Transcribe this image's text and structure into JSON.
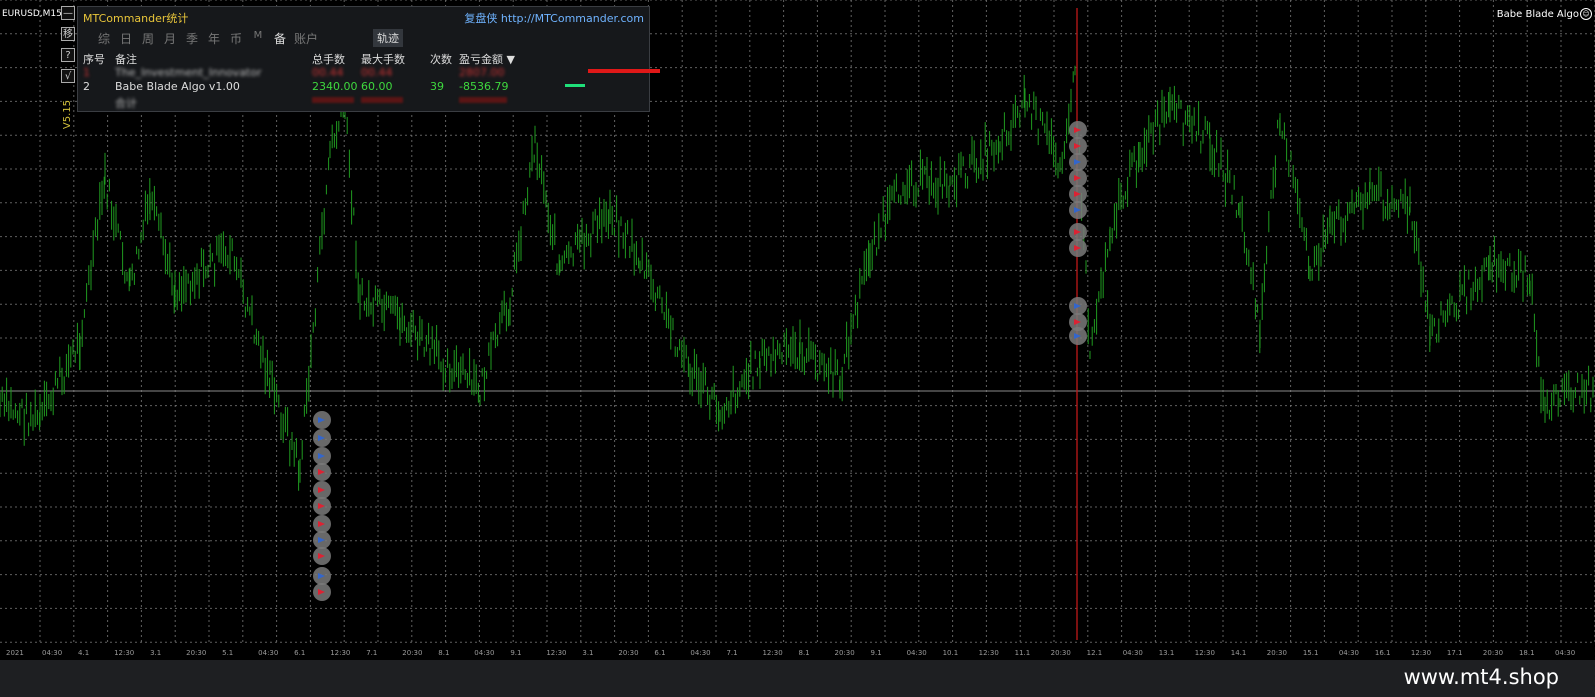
{
  "chart": {
    "symbol": "EURUSD,M15",
    "ea_name": "Babe Blade Algo",
    "smile_icon": "smile-icon",
    "version_label": "V5.15",
    "colors": {
      "background": "#000000",
      "grid": "#7a7a7a",
      "candles": "#1f9a1f",
      "cursor_line": "#c01818",
      "price_line": "#8a8a8a"
    }
  },
  "side_buttons": [
    {
      "label": "—",
      "icon": "minimize-icon"
    },
    {
      "label": "移",
      "icon": "move-icon"
    },
    {
      "label": "?",
      "icon": "help-icon"
    },
    {
      "label": "√",
      "icon": "check-icon"
    }
  ],
  "panel": {
    "title": "MTCommander统计",
    "link": "复盘侠 http://MTCommander.com",
    "tabs": [
      "综",
      "日",
      "周",
      "月",
      "季",
      "年",
      "币",
      "M",
      "备",
      "账户"
    ],
    "active_tab": "备",
    "trail_button": "轨迹",
    "headers": {
      "seq": "序号",
      "note": "备注",
      "total_lots": "总手数",
      "max_lots": "最大手数",
      "count": "次数",
      "pnl": "盈亏金额 ▼"
    },
    "rows": [
      {
        "seq": "1",
        "note": "The_Investment_Innovator",
        "total": "00.44",
        "max": "00.44",
        "count": "",
        "pnl": "2807.00",
        "blurred": true
      },
      {
        "seq": "2",
        "note": "Babe Blade Algo v1.00",
        "total": "2340.00",
        "max": "60.00",
        "count": "39",
        "pnl": "-8536.79",
        "blurred": false
      },
      {
        "seq": "",
        "note": "合计",
        "total": "",
        "max": "",
        "count": "",
        "pnl": "",
        "blurred": true
      }
    ]
  },
  "xaxis_labels": [
    "2021",
    "04:30",
    "4.1",
    "12:30",
    "3.1",
    "20:30",
    "5.1",
    "04:30",
    "6.1",
    "12:30",
    "7.1",
    "20:30",
    "8.1",
    "04:30",
    "9.1",
    "12:30",
    "3.1",
    "20:30",
    "6.1",
    "04:30",
    "7.1",
    "12:30",
    "8.1",
    "20:30",
    "9.1",
    "04:30",
    "10.1",
    "12:30",
    "11.1",
    "20:30",
    "12.1",
    "04:30",
    "13.1",
    "12:30",
    "14.1",
    "20:30",
    "15.1",
    "04:30",
    "16.1",
    "12:30",
    "17.1",
    "20:30",
    "18.1",
    "04:30"
  ],
  "footer": {
    "watermark": "www.mt4.shop"
  }
}
